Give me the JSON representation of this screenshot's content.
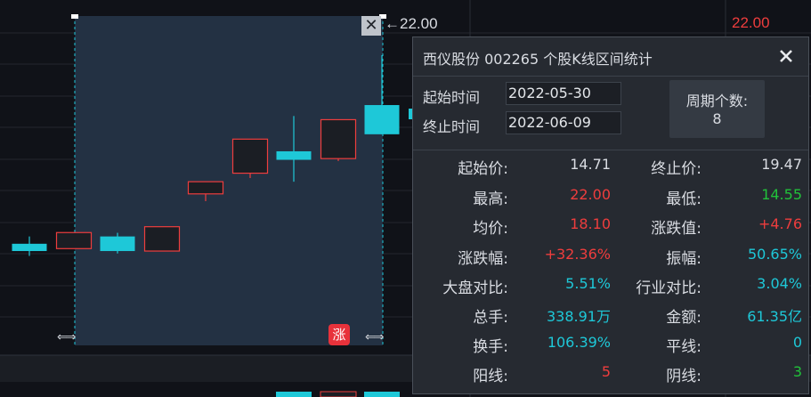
{
  "chart": {
    "price_tag": "22.00",
    "price_marker": "←22.00",
    "zhang_badge": "涨",
    "select_arrows": "⇐⇒",
    "close_selection_glyph": "✕",
    "colors": {
      "up": "#ee3d3d",
      "down": "#1ec8d8",
      "selection": "#233143",
      "selection_border": "#1ec8d8"
    },
    "candles": [
      {
        "o": 13.95,
        "c": 14.25,
        "h": 14.55,
        "l": 13.75,
        "dir": "down"
      },
      {
        "o": 14.05,
        "c": 14.71,
        "h": 14.71,
        "l": 14.05,
        "dir": "up"
      },
      {
        "o": 14.55,
        "c": 13.95,
        "h": 14.7,
        "l": 13.85,
        "dir": "down"
      },
      {
        "o": 13.95,
        "c": 14.95,
        "h": 14.95,
        "l": 13.95,
        "dir": "up"
      },
      {
        "o": 16.3,
        "c": 16.8,
        "h": 16.8,
        "l": 16.0,
        "dir": "up"
      },
      {
        "o": 17.15,
        "c": 18.55,
        "h": 18.55,
        "l": 16.95,
        "dir": "up"
      },
      {
        "o": 18.05,
        "c": 17.7,
        "h": 19.5,
        "l": 16.8,
        "dir": "down"
      },
      {
        "o": 17.75,
        "c": 19.35,
        "h": 19.35,
        "l": 17.65,
        "dir": "up"
      },
      {
        "o": 19.95,
        "c": 18.75,
        "h": 22.0,
        "l": 18.75,
        "dir": "down"
      }
    ]
  },
  "panel": {
    "title": "西仪股份  002265  个股K线区间统计",
    "close_icon": "✕",
    "start_label": "起始时间",
    "start_value": "2022-05-30",
    "end_label": "终止时间",
    "end_value": "2022-06-09",
    "period_label": "周期个数:",
    "period_value": "8",
    "rows": [
      {
        "k1": "起始价:",
        "v1": "14.71",
        "c1": "#d9dce2",
        "k2": "终止价:",
        "v2": "19.47",
        "c2": "#d9dce2"
      },
      {
        "k1": "最高:",
        "v1": "22.00",
        "c1": "#ee3d3d",
        "k2": "最低:",
        "v2": "14.55",
        "c2": "#21c23a"
      },
      {
        "k1": "均价:",
        "v1": "18.10",
        "c1": "#ee3d3d",
        "k2": "涨跌值:",
        "v2": "+4.76",
        "c2": "#ee3d3d"
      },
      {
        "k1": "涨跌幅:",
        "v1": "+32.36%",
        "c1": "#ee3d3d",
        "k2": "振幅:",
        "v2": "50.65%",
        "c2": "#1ec8d8"
      },
      {
        "k1": "大盘对比:",
        "v1": "5.51%",
        "c1": "#1ec8d8",
        "k2": "行业对比:",
        "v2": "3.04%",
        "c2": "#1ec8d8"
      },
      {
        "k1": "总手:",
        "v1": "338.91万",
        "c1": "#1ec8d8",
        "k2": "金额:",
        "v2": "61.35亿",
        "c2": "#1ec8d8"
      },
      {
        "k1": "换手:",
        "v1": "106.39%",
        "c1": "#1ec8d8",
        "k2": "平线:",
        "v2": "0",
        "c2": "#1ec8d8"
      },
      {
        "k1": "阳线:",
        "v1": "5",
        "c1": "#ee3d3d",
        "k2": "阴线:",
        "v2": "3",
        "c2": "#21c23a"
      }
    ]
  }
}
